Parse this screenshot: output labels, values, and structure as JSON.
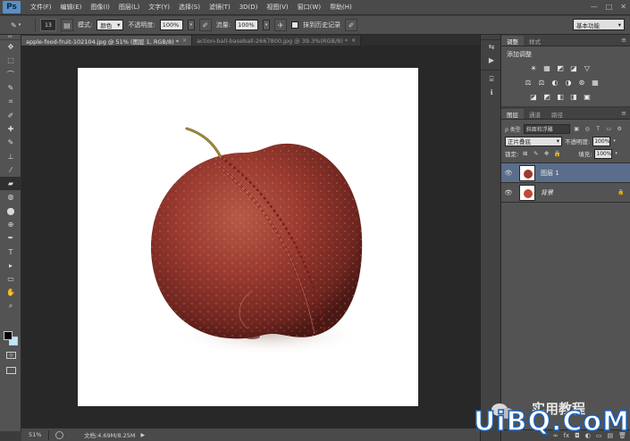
{
  "app": {
    "logo_text": "Ps",
    "menu": [
      "文件(F)",
      "编辑(E)",
      "图像(I)",
      "图层(L)",
      "文字(Y)",
      "选择(S)",
      "滤镜(T)",
      "3D(D)",
      "视图(V)",
      "窗口(W)",
      "帮助(H)"
    ],
    "window_controls": [
      "—",
      "□",
      "✕"
    ]
  },
  "options": {
    "brush_size": "13",
    "mode_label": "模式:",
    "mode_value": "颜色",
    "opacity_label": "不透明度:",
    "opacity_value": "100%",
    "flow_label": "流量:",
    "flow_value": "100%",
    "history_label": "抹到历史记录",
    "workspace": "基本功能"
  },
  "tabs": [
    {
      "label": "apple-food-fruit-102104.jpg @ 51% (图层 1, RGB/8) *",
      "close": "×"
    },
    {
      "label": "action-ball-baseball-2667800.jpg @ 39.3%(RGB/8) *",
      "close": "×"
    }
  ],
  "toolbar": {
    "grip": "▸▸",
    "tools": [
      "✥",
      "⬚",
      "⌒",
      "✎",
      "⌗",
      "✐",
      "✚",
      "✎",
      "⊥",
      "⁄",
      "▰",
      "◍",
      "⬤",
      "⊕",
      "✒",
      "T",
      "▸",
      "▭",
      "✋",
      "⌕"
    ],
    "quick_mask": "◎"
  },
  "status": {
    "zoom": "51%",
    "doc": "文档:4.69M/8.25M",
    "arrow": "▶"
  },
  "side_icons": [
    "⇆",
    "▶",
    "⌸",
    "ℹ"
  ],
  "adjustments": {
    "tabs": [
      "调整",
      "样式"
    ],
    "menu": "≡",
    "title": "添加调整",
    "row1": [
      "☀",
      "▦",
      "◩",
      "◪",
      "▽"
    ],
    "row2": [
      "⚖",
      "⚖",
      "◐",
      "◑",
      "⊛",
      "▦"
    ],
    "row3": [
      "◪",
      "◩",
      "◧",
      "◨",
      "▣"
    ]
  },
  "layers": {
    "tabs": [
      "图层",
      "通道",
      "路径"
    ],
    "menu": "≡",
    "kind_label": "ρ 类型",
    "kind_value": "斜面和浮雕",
    "filter_icons": [
      "▣",
      "◎",
      "T",
      "▭",
      "⚙"
    ],
    "blend_mode": "正片叠底",
    "opacity_label": "不透明度:",
    "opacity_value": "100%",
    "lock_label": "锁定:",
    "lock_icons": [
      "⊠",
      "✎",
      "✥",
      "🔒"
    ],
    "fill_label": "填充:",
    "fill_value": "100%",
    "list": [
      {
        "name": "图层 1",
        "selected": true,
        "eye": "👁",
        "lock": ""
      },
      {
        "name": "背景",
        "selected": false,
        "eye": "👁",
        "lock": "🔒"
      }
    ],
    "bottom_icons": [
      "∞",
      "fx",
      "◘",
      "◐",
      "▭",
      "▤",
      "🗑"
    ]
  },
  "watermark": {
    "text": "UiBQ.CoM",
    "cjk": "实用教程"
  }
}
